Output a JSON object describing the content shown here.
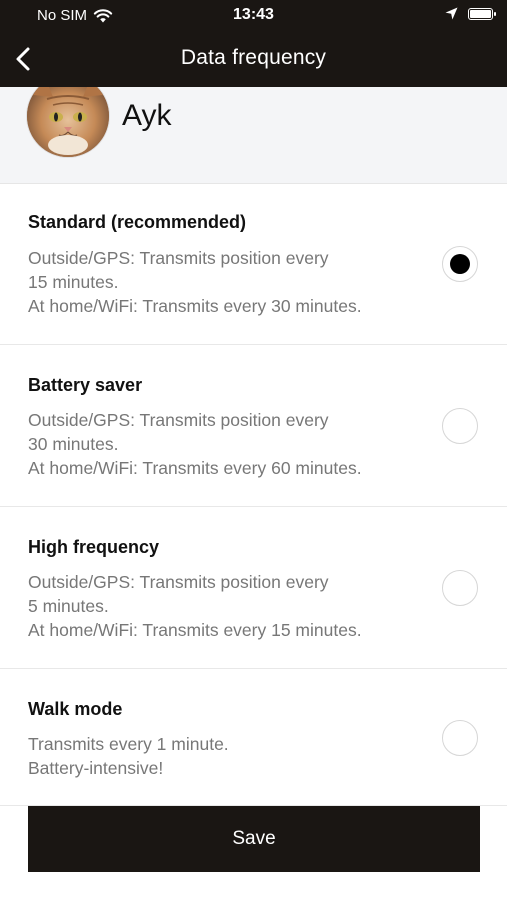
{
  "status_bar": {
    "carrier": "No SIM",
    "time": "13:43",
    "icons": [
      "wifi-icon",
      "location-arrow-icon",
      "battery-icon"
    ]
  },
  "nav": {
    "title": "Data frequency",
    "back_icon": "chevron-left-icon"
  },
  "pet": {
    "name": "Ayk",
    "avatar": "cat-photo"
  },
  "options": [
    {
      "name": "Standard (recommended)",
      "desc": [
        "Outside/GPS: Transmits position every",
        "15 minutes.",
        "At home/WiFi: Transmits every 30 minutes."
      ],
      "selected": true
    },
    {
      "name": "Battery saver",
      "desc": [
        "Outside/GPS: Transmits position every",
        "30 minutes.",
        "At home/WiFi: Transmits every 60 minutes."
      ],
      "selected": false
    },
    {
      "name": "High frequency",
      "desc": [
        "Outside/GPS: Transmits position every",
        "5 minutes.",
        "At home/WiFi: Transmits every 15 minutes."
      ],
      "selected": false
    },
    {
      "name": "Walk mode",
      "desc": [
        "Transmits every 1 minute.",
        "Battery-intensive!"
      ],
      "selected": false
    }
  ],
  "save_label": "Save",
  "colors": {
    "bar": "#1a1613",
    "selected_dot": "#000000",
    "secondary_text": "#777777"
  }
}
